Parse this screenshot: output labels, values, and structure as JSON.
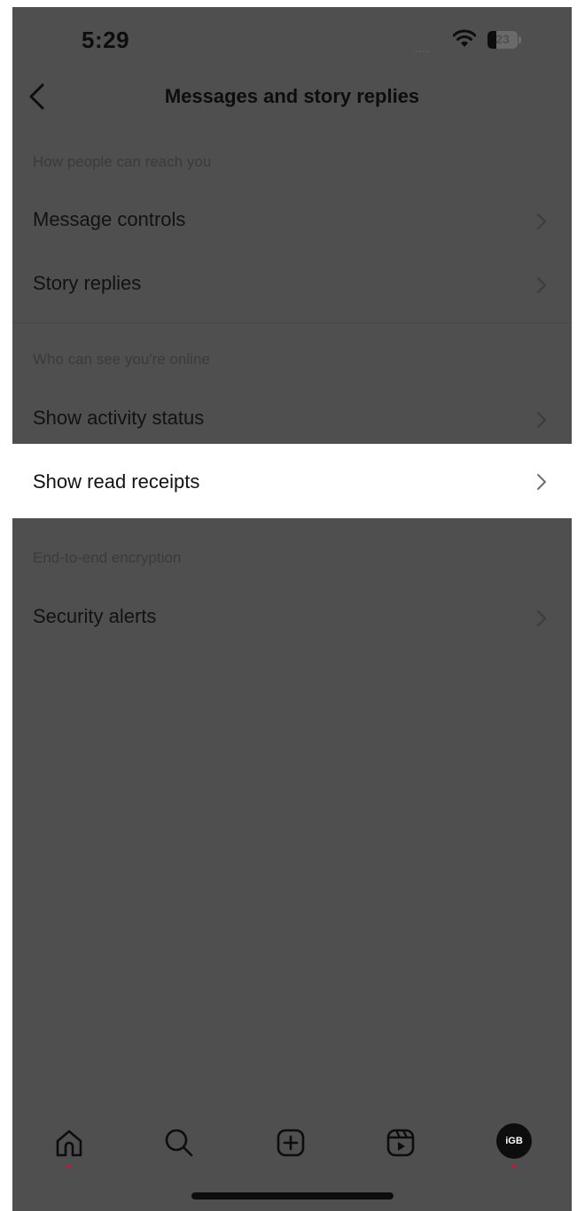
{
  "status_bar": {
    "time": "5:29",
    "signal": "....",
    "battery_level": "23",
    "icons": [
      "wifi-icon",
      "battery-icon"
    ]
  },
  "header": {
    "back_icon": "chevron-left-icon",
    "title": "Messages and story replies"
  },
  "sections": [
    {
      "header": "How people can reach you",
      "items": [
        {
          "label": "Message controls"
        },
        {
          "label": "Story replies"
        }
      ]
    },
    {
      "header": "Who can see you're online",
      "items": [
        {
          "label": "Show activity status"
        },
        {
          "label": "Show read receipts",
          "highlighted": true
        }
      ]
    },
    {
      "header": "End-to-end encryption",
      "items": [
        {
          "label": "Security alerts"
        }
      ]
    }
  ],
  "tab_bar": {
    "tabs": [
      {
        "icon": "home-icon",
        "has_notification_dot": true
      },
      {
        "icon": "search-icon",
        "has_notification_dot": false
      },
      {
        "icon": "create-post-icon",
        "has_notification_dot": false
      },
      {
        "icon": "reels-icon",
        "has_notification_dot": false
      },
      {
        "icon": "profile-avatar",
        "label": "iGB",
        "has_notification_dot": true
      }
    ]
  },
  "colors": {
    "dim_overlay": "#4f4f4f",
    "highlight": "#ffffff",
    "text": "#121212",
    "notification_dot": "#b4213a"
  }
}
